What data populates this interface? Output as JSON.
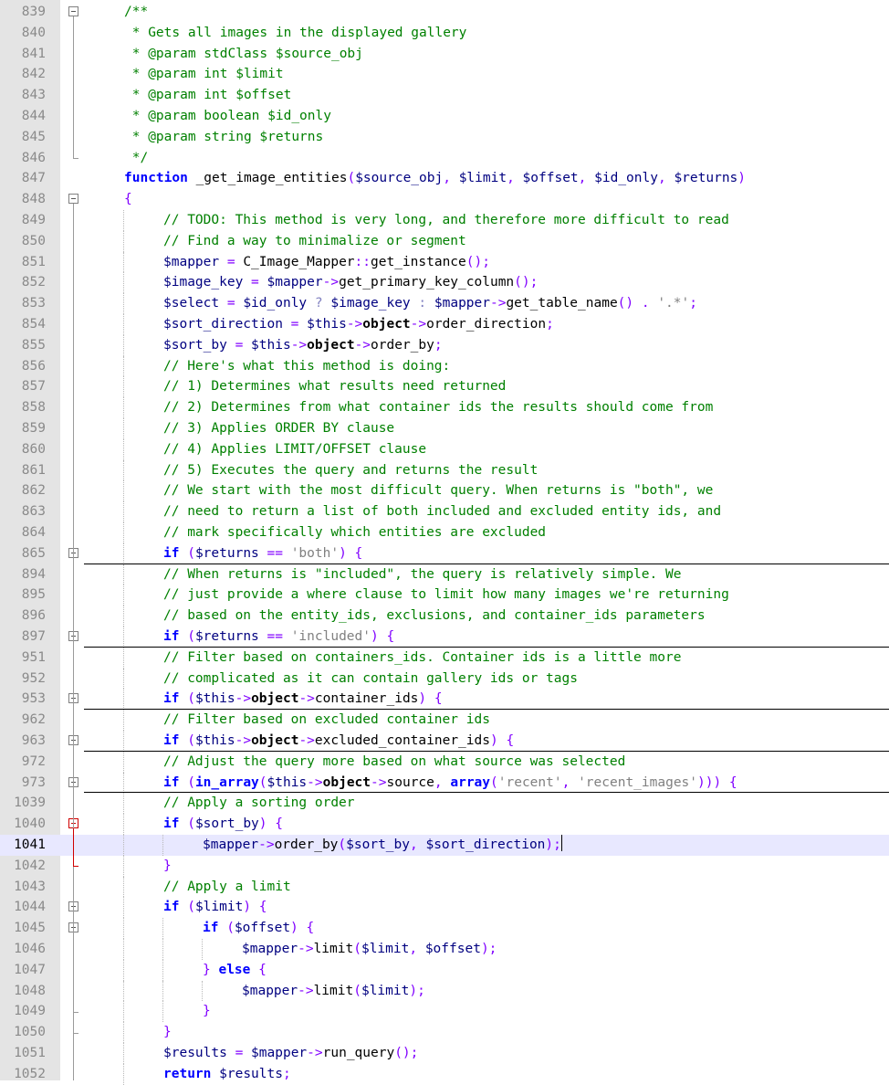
{
  "editor": {
    "lines": [
      {
        "n": "839",
        "fold": "minus",
        "guide": 0,
        "tokens": [
          [
            "cm",
            "/**"
          ]
        ]
      },
      {
        "n": "840",
        "fold": "",
        "guide": 0,
        "tokens": [
          [
            "cm",
            " * Gets all images in the displayed gallery"
          ]
        ]
      },
      {
        "n": "841",
        "fold": "",
        "guide": 0,
        "tokens": [
          [
            "cm",
            " * @param stdClass $source_obj"
          ]
        ]
      },
      {
        "n": "842",
        "fold": "",
        "guide": 0,
        "tokens": [
          [
            "cm",
            " * @param int $limit"
          ]
        ]
      },
      {
        "n": "843",
        "fold": "",
        "guide": 0,
        "tokens": [
          [
            "cm",
            " * @param int $offset"
          ]
        ]
      },
      {
        "n": "844",
        "fold": "",
        "guide": 0,
        "tokens": [
          [
            "cm",
            " * @param boolean $id_only"
          ]
        ]
      },
      {
        "n": "845",
        "fold": "",
        "guide": 0,
        "tokens": [
          [
            "cm",
            " * @param string $returns"
          ]
        ]
      },
      {
        "n": "846",
        "fold": "end",
        "guide": 0,
        "tokens": [
          [
            "cm",
            " */"
          ]
        ]
      },
      {
        "n": "847",
        "fold": "",
        "guide": 0,
        "tokens": [
          [
            "kw",
            "function"
          ],
          [
            "nm",
            " _get_image_entities"
          ],
          [
            "op",
            "("
          ],
          [
            "var",
            "$source_obj"
          ],
          [
            "op",
            ", "
          ],
          [
            "var",
            "$limit"
          ],
          [
            "op",
            ", "
          ],
          [
            "var",
            "$offset"
          ],
          [
            "op",
            ", "
          ],
          [
            "var",
            "$id_only"
          ],
          [
            "op",
            ", "
          ],
          [
            "var",
            "$returns"
          ],
          [
            "op",
            ")"
          ]
        ]
      },
      {
        "n": "848",
        "fold": "minus",
        "guide": 0,
        "tokens": [
          [
            "op",
            "{"
          ]
        ]
      },
      {
        "n": "849",
        "fold": "",
        "guide": 1,
        "tokens": [
          [
            "cm",
            "// TODO: This method is very long, and therefore more difficult to read"
          ]
        ]
      },
      {
        "n": "850",
        "fold": "",
        "guide": 1,
        "tokens": [
          [
            "cm",
            "// Find a way to minimalize or segment"
          ]
        ]
      },
      {
        "n": "851",
        "fold": "",
        "guide": 1,
        "tokens": [
          [
            "var",
            "$mapper"
          ],
          [
            "op",
            " = "
          ],
          [
            "nm",
            "C_Image_Mapper"
          ],
          [
            "op",
            "::"
          ],
          [
            "nm",
            "get_instance"
          ],
          [
            "op",
            "();"
          ]
        ]
      },
      {
        "n": "852",
        "fold": "",
        "guide": 1,
        "tokens": [
          [
            "var",
            "$image_key"
          ],
          [
            "op",
            " = "
          ],
          [
            "var",
            "$mapper"
          ],
          [
            "op",
            "->"
          ],
          [
            "nm",
            "get_primary_key_column"
          ],
          [
            "op",
            "();"
          ]
        ]
      },
      {
        "n": "853",
        "fold": "",
        "guide": 1,
        "tokens": [
          [
            "var",
            "$select"
          ],
          [
            "op",
            " = "
          ],
          [
            "var",
            "$id_only"
          ],
          [
            "op2",
            " ? "
          ],
          [
            "var",
            "$image_key"
          ],
          [
            "op2",
            " : "
          ],
          [
            "var",
            "$mapper"
          ],
          [
            "op",
            "->"
          ],
          [
            "nm",
            "get_table_name"
          ],
          [
            "op",
            "() . "
          ],
          [
            "str",
            "'.*'"
          ],
          [
            "op",
            ";"
          ]
        ]
      },
      {
        "n": "854",
        "fold": "",
        "guide": 1,
        "tokens": [
          [
            "var",
            "$sort_direction"
          ],
          [
            "op",
            " = "
          ],
          [
            "var",
            "$this"
          ],
          [
            "op",
            "->"
          ],
          [
            "pr",
            "object"
          ],
          [
            "op",
            "->"
          ],
          [
            "nm",
            "order_direction"
          ],
          [
            "op",
            ";"
          ]
        ]
      },
      {
        "n": "855",
        "fold": "",
        "guide": 1,
        "tokens": [
          [
            "var",
            "$sort_by"
          ],
          [
            "op",
            " = "
          ],
          [
            "var",
            "$this"
          ],
          [
            "op",
            "->"
          ],
          [
            "pr",
            "object"
          ],
          [
            "op",
            "->"
          ],
          [
            "nm",
            "order_by"
          ],
          [
            "op",
            ";"
          ]
        ]
      },
      {
        "n": "856",
        "fold": "",
        "guide": 1,
        "tokens": [
          [
            "cm",
            "// Here's what this method is doing:"
          ]
        ]
      },
      {
        "n": "857",
        "fold": "",
        "guide": 1,
        "tokens": [
          [
            "cm",
            "// 1) Determines what results need returned"
          ]
        ]
      },
      {
        "n": "858",
        "fold": "",
        "guide": 1,
        "tokens": [
          [
            "cm",
            "// 2) Determines from what container ids the results should come from"
          ]
        ]
      },
      {
        "n": "859",
        "fold": "",
        "guide": 1,
        "tokens": [
          [
            "cm",
            "// 3) Applies ORDER BY clause"
          ]
        ]
      },
      {
        "n": "860",
        "fold": "",
        "guide": 1,
        "tokens": [
          [
            "cm",
            "// 4) Applies LIMIT/OFFSET clause"
          ]
        ]
      },
      {
        "n": "861",
        "fold": "",
        "guide": 1,
        "tokens": [
          [
            "cm",
            "// 5) Executes the query and returns the result"
          ]
        ]
      },
      {
        "n": "862",
        "fold": "",
        "guide": 1,
        "tokens": [
          [
            "cm",
            "// We start with the most difficult query. When returns is \"both\", we"
          ]
        ]
      },
      {
        "n": "863",
        "fold": "",
        "guide": 1,
        "tokens": [
          [
            "cm",
            "// need to return a list of both included and excluded entity ids, and"
          ]
        ]
      },
      {
        "n": "864",
        "fold": "",
        "guide": 1,
        "tokens": [
          [
            "cm",
            "// mark specifically which entities are excluded"
          ]
        ]
      },
      {
        "n": "865",
        "fold": "plus",
        "guide": 1,
        "sep": true,
        "tokens": [
          [
            "kw",
            "if"
          ],
          [
            "op",
            " ("
          ],
          [
            "var",
            "$returns"
          ],
          [
            "op",
            " == "
          ],
          [
            "str",
            "'both'"
          ],
          [
            "op",
            ") {"
          ]
        ]
      },
      {
        "n": "894",
        "fold": "",
        "guide": 1,
        "tokens": [
          [
            "cm",
            "// When returns is \"included\", the query is relatively simple. We"
          ]
        ]
      },
      {
        "n": "895",
        "fold": "",
        "guide": 1,
        "tokens": [
          [
            "cm",
            "// just provide a where clause to limit how many images we're returning"
          ]
        ]
      },
      {
        "n": "896",
        "fold": "",
        "guide": 1,
        "tokens": [
          [
            "cm",
            "// based on the entity_ids, exclusions, and container_ids parameters"
          ]
        ]
      },
      {
        "n": "897",
        "fold": "plus",
        "guide": 1,
        "sep": true,
        "tokens": [
          [
            "kw",
            "if"
          ],
          [
            "op",
            " ("
          ],
          [
            "var",
            "$returns"
          ],
          [
            "op",
            " == "
          ],
          [
            "str",
            "'included'"
          ],
          [
            "op",
            ") {"
          ]
        ]
      },
      {
        "n": "951",
        "fold": "",
        "guide": 1,
        "tokens": [
          [
            "cm",
            "// Filter based on containers_ids. Container ids is a little more"
          ]
        ]
      },
      {
        "n": "952",
        "fold": "",
        "guide": 1,
        "tokens": [
          [
            "cm",
            "// complicated as it can contain gallery ids or tags"
          ]
        ]
      },
      {
        "n": "953",
        "fold": "plus",
        "guide": 1,
        "sep": true,
        "tokens": [
          [
            "kw",
            "if"
          ],
          [
            "op",
            " ("
          ],
          [
            "var",
            "$this"
          ],
          [
            "op",
            "->"
          ],
          [
            "pr",
            "object"
          ],
          [
            "op",
            "->"
          ],
          [
            "nm",
            "container_ids"
          ],
          [
            "op",
            ") {"
          ]
        ]
      },
      {
        "n": "962",
        "fold": "",
        "guide": 1,
        "tokens": [
          [
            "cm",
            "// Filter based on excluded container ids"
          ]
        ]
      },
      {
        "n": "963",
        "fold": "plus",
        "guide": 1,
        "sep": true,
        "tokens": [
          [
            "kw",
            "if"
          ],
          [
            "op",
            " ("
          ],
          [
            "var",
            "$this"
          ],
          [
            "op",
            "->"
          ],
          [
            "pr",
            "object"
          ],
          [
            "op",
            "->"
          ],
          [
            "nm",
            "excluded_container_ids"
          ],
          [
            "op",
            ") {"
          ]
        ]
      },
      {
        "n": "972",
        "fold": "",
        "guide": 1,
        "tokens": [
          [
            "cm",
            "// Adjust the query more based on what source was selected"
          ]
        ]
      },
      {
        "n": "973",
        "fold": "plus",
        "guide": 1,
        "sep": true,
        "tokens": [
          [
            "kw",
            "if"
          ],
          [
            "op",
            " ("
          ],
          [
            "kw",
            "in_array"
          ],
          [
            "op",
            "("
          ],
          [
            "var",
            "$this"
          ],
          [
            "op",
            "->"
          ],
          [
            "pr",
            "object"
          ],
          [
            "op",
            "->"
          ],
          [
            "nm",
            "source"
          ],
          [
            "op",
            ", "
          ],
          [
            "kw",
            "array"
          ],
          [
            "op",
            "("
          ],
          [
            "str",
            "'recent'"
          ],
          [
            "op",
            ", "
          ],
          [
            "str",
            "'recent_images'"
          ],
          [
            "op",
            "))) {"
          ]
        ]
      },
      {
        "n": "1039",
        "fold": "",
        "guide": 1,
        "tokens": [
          [
            "cm",
            "// Apply a sorting order"
          ]
        ]
      },
      {
        "n": "1040",
        "fold": "redminus",
        "guide": 1,
        "tokens": [
          [
            "kw",
            "if"
          ],
          [
            "op",
            " ("
          ],
          [
            "var",
            "$sort_by"
          ],
          [
            "op",
            ") {"
          ]
        ]
      },
      {
        "n": "1041",
        "fold": "",
        "guide": 2,
        "current": true,
        "tokens": [
          [
            "var",
            "$mapper"
          ],
          [
            "op",
            "->"
          ],
          [
            "nm",
            "order_by"
          ],
          [
            "op",
            "("
          ],
          [
            "var",
            "$sort_by"
          ],
          [
            "op",
            ", "
          ],
          [
            "var",
            "$sort_direction"
          ],
          [
            "op",
            ");"
          ]
        ]
      },
      {
        "n": "1042",
        "fold": "redend",
        "guide": 1,
        "tokens": [
          [
            "op",
            "}"
          ]
        ]
      },
      {
        "n": "1043",
        "fold": "",
        "guide": 1,
        "tokens": [
          [
            "cm",
            "// Apply a limit"
          ]
        ]
      },
      {
        "n": "1044",
        "fold": "minus",
        "guide": 1,
        "tokens": [
          [
            "kw",
            "if"
          ],
          [
            "op",
            " ("
          ],
          [
            "var",
            "$limit"
          ],
          [
            "op",
            ") {"
          ]
        ]
      },
      {
        "n": "1045",
        "fold": "minus",
        "guide": 2,
        "tokens": [
          [
            "kw",
            "if"
          ],
          [
            "op",
            " ("
          ],
          [
            "var",
            "$offset"
          ],
          [
            "op",
            ") {"
          ]
        ]
      },
      {
        "n": "1046",
        "fold": "",
        "guide": 3,
        "tokens": [
          [
            "var",
            "$mapper"
          ],
          [
            "op",
            "->"
          ],
          [
            "nm",
            "limit"
          ],
          [
            "op",
            "("
          ],
          [
            "var",
            "$limit"
          ],
          [
            "op",
            ", "
          ],
          [
            "var",
            "$offset"
          ],
          [
            "op",
            ");"
          ]
        ]
      },
      {
        "n": "1047",
        "fold": "",
        "guide": 2,
        "tokens": [
          [
            "op",
            "} "
          ],
          [
            "kw",
            "else"
          ],
          [
            "op",
            " {"
          ]
        ]
      },
      {
        "n": "1048",
        "fold": "",
        "guide": 3,
        "tokens": [
          [
            "var",
            "$mapper"
          ],
          [
            "op",
            "->"
          ],
          [
            "nm",
            "limit"
          ],
          [
            "op",
            "("
          ],
          [
            "var",
            "$limit"
          ],
          [
            "op",
            ");"
          ]
        ]
      },
      {
        "n": "1049",
        "fold": "end",
        "guide": 2,
        "tokens": [
          [
            "op",
            "}"
          ]
        ]
      },
      {
        "n": "1050",
        "fold": "end",
        "guide": 1,
        "tokens": [
          [
            "op",
            "}"
          ]
        ]
      },
      {
        "n": "1051",
        "fold": "",
        "guide": 1,
        "tokens": [
          [
            "var",
            "$results"
          ],
          [
            "op",
            " = "
          ],
          [
            "var",
            "$mapper"
          ],
          [
            "op",
            "->"
          ],
          [
            "nm",
            "run_query"
          ],
          [
            "op",
            "();"
          ]
        ]
      },
      {
        "n": "1052",
        "fold": "",
        "guide": 1,
        "tokens": [
          [
            "kw",
            "return"
          ],
          [
            "op",
            " "
          ],
          [
            "var",
            "$results"
          ],
          [
            "op",
            ";"
          ]
        ]
      }
    ]
  }
}
